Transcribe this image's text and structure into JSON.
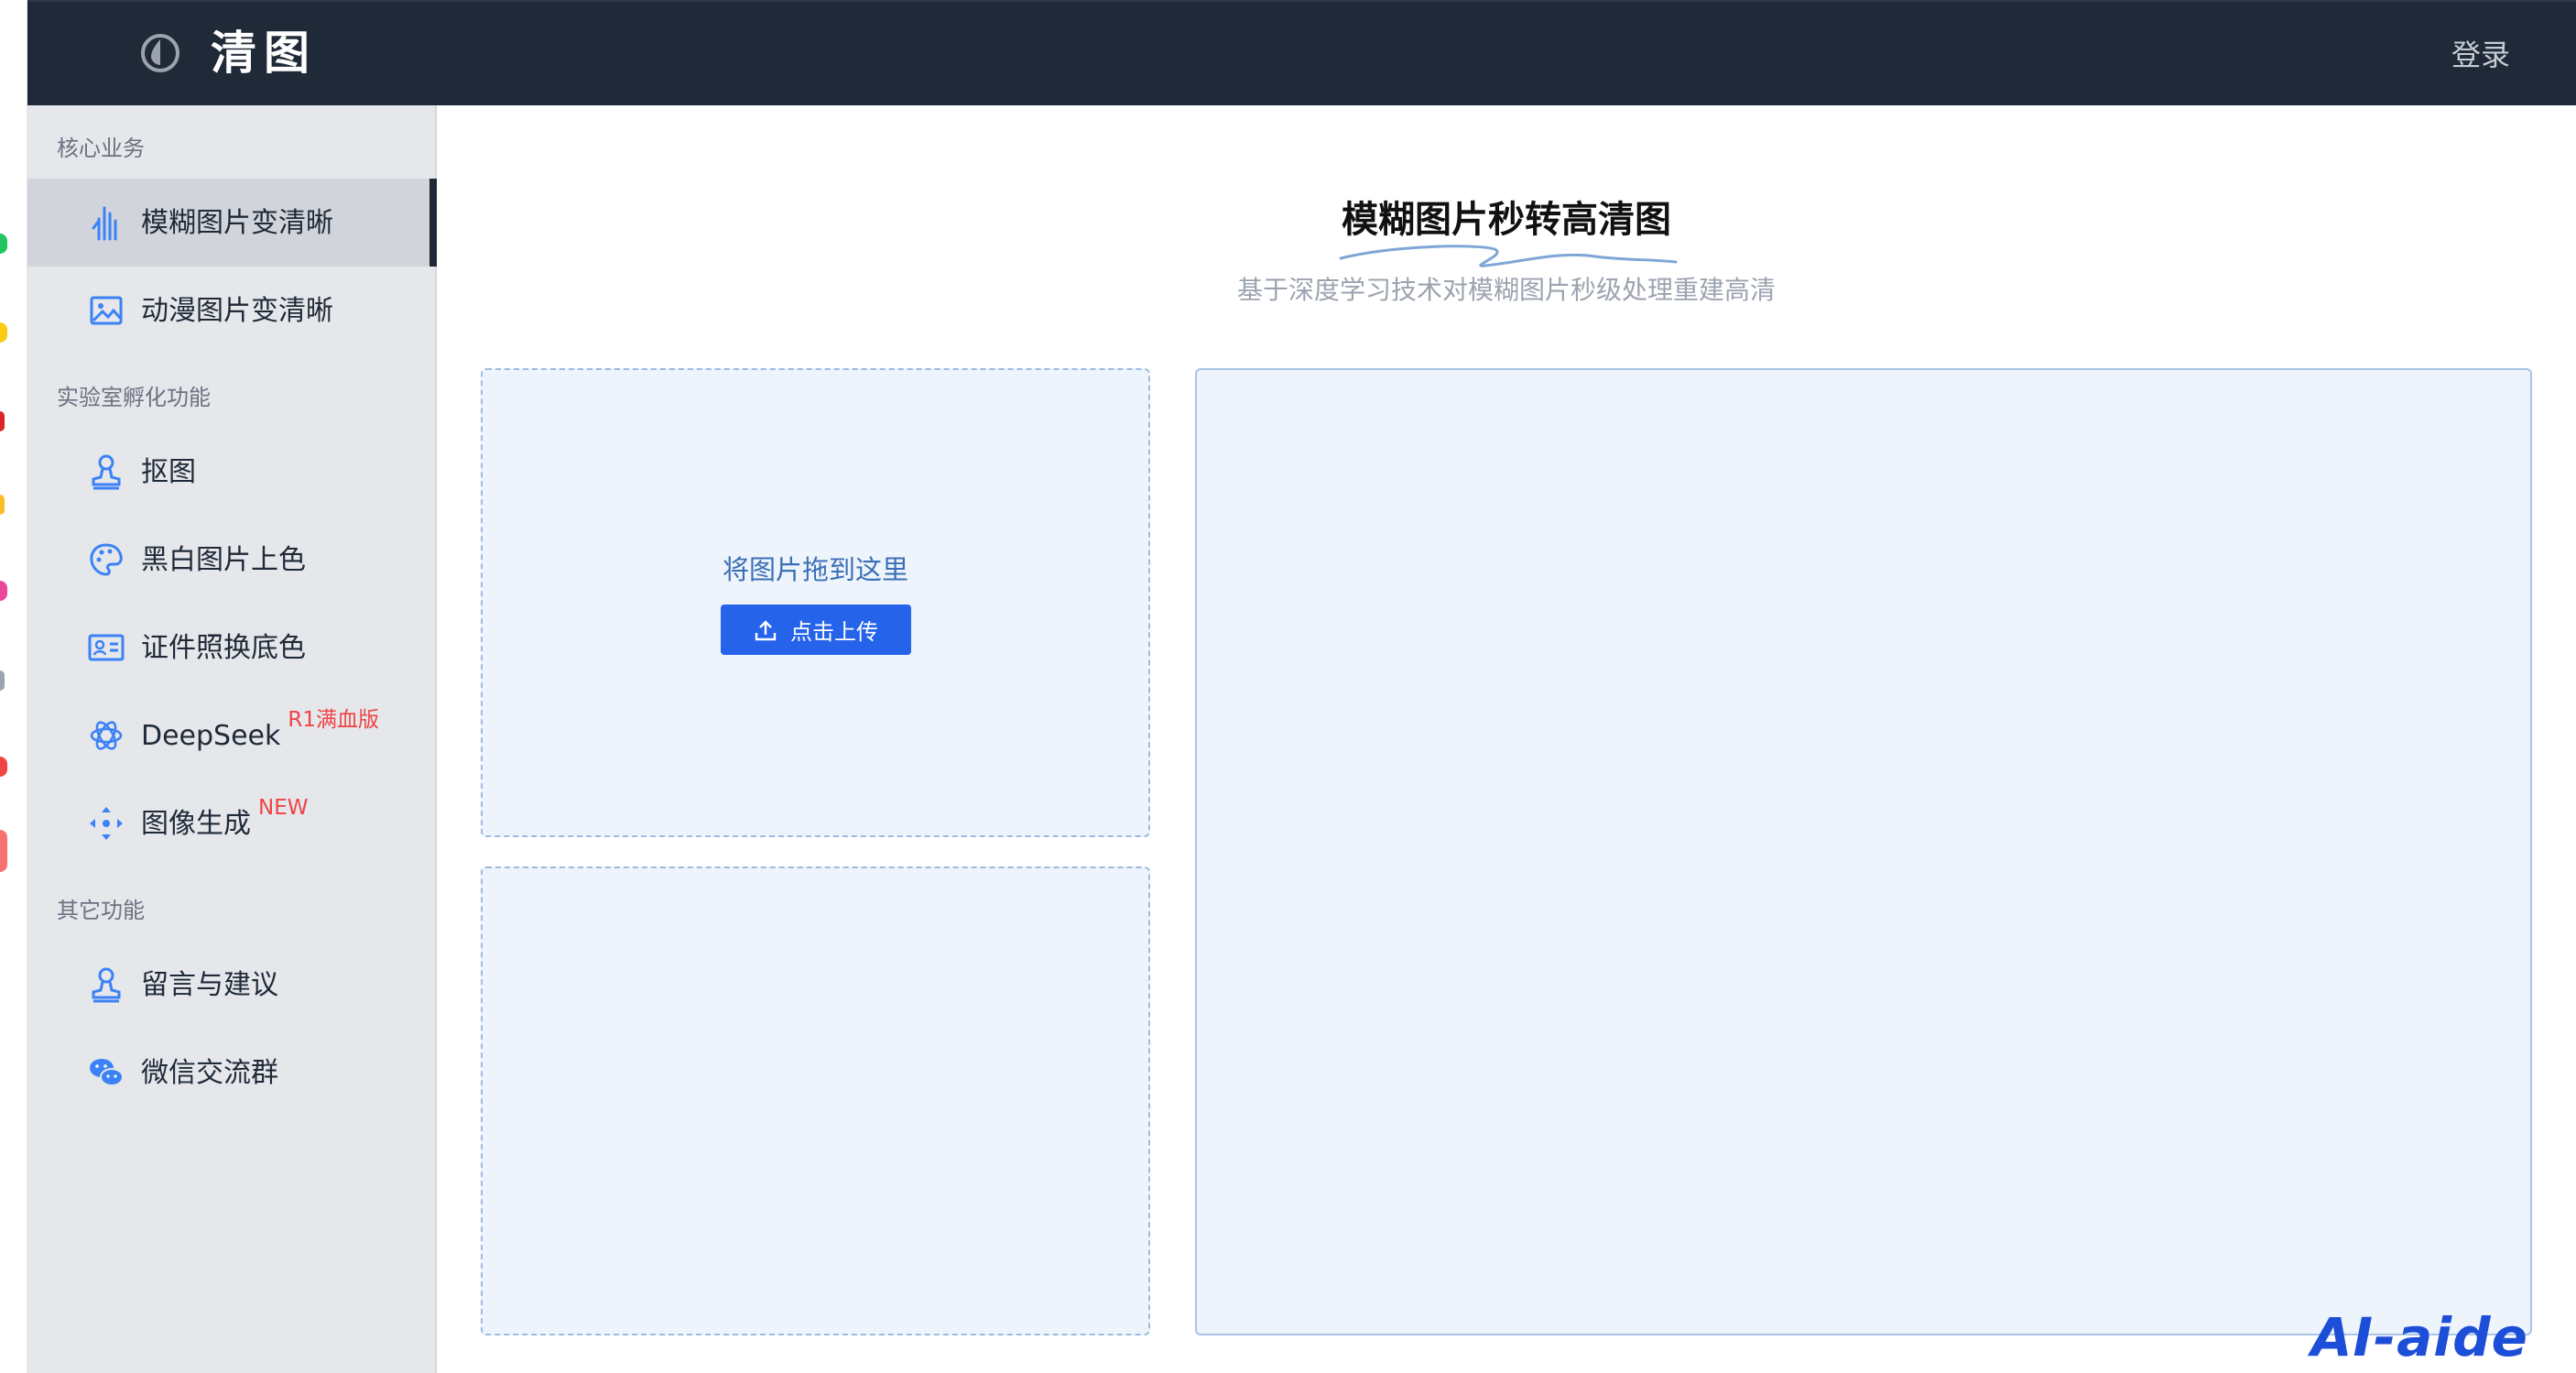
{
  "header": {
    "brand": "清图",
    "login": "登录"
  },
  "sidebar": {
    "groups": [
      {
        "title": "核心业务"
      },
      {
        "title": "实验室孵化功能"
      },
      {
        "title": "其它功能"
      }
    ],
    "items": [
      {
        "label": "模糊图片变清晰",
        "icon": "hand-icon",
        "active": true
      },
      {
        "label": "动漫图片变清晰",
        "icon": "image-icon"
      },
      {
        "label": "抠图",
        "icon": "stamp-icon"
      },
      {
        "label": "黑白图片上色",
        "icon": "palette-icon"
      },
      {
        "label": "证件照换底色",
        "icon": "id-card-icon"
      },
      {
        "label": "DeepSeek",
        "badge": "R1满血版",
        "icon": "openai-icon"
      },
      {
        "label": "图像生成",
        "badge": "NEW",
        "icon": "move-icon"
      },
      {
        "label": "留言与建议",
        "icon": "stamp-icon"
      },
      {
        "label": "微信交流群",
        "icon": "wechat-icon"
      }
    ]
  },
  "main": {
    "title": "模糊图片秒转高清图",
    "subtitle": "基于深度学习技术对模糊图片秒级处理重建高清",
    "drop_text": "将图片拖到这里",
    "upload_label": "点击上传"
  },
  "watermark": "AI-aide",
  "colors": {
    "header_bg": "#1f2937",
    "sidebar_bg": "#e5e7eb",
    "accent_blue": "#2563eb",
    "icon_blue": "#3b82f6",
    "badge_red": "#ef4444"
  }
}
